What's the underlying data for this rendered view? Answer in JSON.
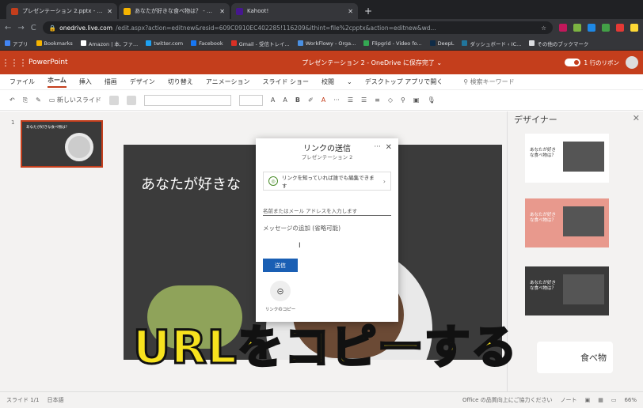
{
  "browser": {
    "tabs": [
      {
        "label": "プレゼンテーション 2.pptx - Micr",
        "color": "#c43e1c",
        "active": true
      },
      {
        "label": "あなたが好きな食べ物は？ - Goo",
        "color": "#f6b400",
        "active": false
      },
      {
        "label": "Kahoot!",
        "color": "#46178f",
        "active": false
      }
    ],
    "new_tab": "+",
    "address": {
      "host": "onedrive.live.com",
      "path": "/edit.aspx?action=editnew&resid=609C0910EC402285!116209&ithint=file%2cpptx&action=editnew&wd..."
    },
    "bookmarks": [
      {
        "label": "アプリ",
        "color": "#4285f4"
      },
      {
        "label": "Bookmarks",
        "color": "#f6b400"
      },
      {
        "label": "Amazon | 本, ファ...",
        "color": "#ffffff"
      },
      {
        "label": "twitter.com",
        "color": "#1da1f2"
      },
      {
        "label": "Facebook",
        "color": "#1877f2"
      },
      {
        "label": "Gmail - 受信トレイ...",
        "color": "#d93025"
      },
      {
        "label": "WorkFlowy - Orga...",
        "color": "#4a90e2"
      },
      {
        "label": "Flipgrid - Video fo...",
        "color": "#34a853"
      },
      {
        "label": "DeepL",
        "color": "#0f2b46"
      },
      {
        "label": "ダッシュボード ‹ IC...",
        "color": "#21759b"
      },
      {
        "label": "その他のブックマーク",
        "color": "#dadce0"
      }
    ]
  },
  "ppt": {
    "app_name": "PowerPoint",
    "doc_title": "プレゼンテーション 2 - OneDrive に保存完了 ⌄",
    "ribbon_toggle": "1 行のリボン",
    "brand_color": "#c43e1c",
    "menu": [
      "ファイル",
      "ホーム",
      "挿入",
      "描画",
      "デザイン",
      "切り替え",
      "アニメーション",
      "スライド ショー",
      "校閲",
      "⌄",
      "デスクトップ アプリで開く"
    ],
    "search_placeholder": "検索キーワード",
    "toolbar_new_slide": "新しいスライド",
    "slide_number": "1",
    "thumb_title": "あなたが好きな食べ物は？",
    "slide_title": "あなたが好きな",
    "designer": {
      "title": "デザイナー",
      "items": [
        {
          "text": "あなたが好きな食べ物は？",
          "bg": "#ffffff",
          "fg": "#333333"
        },
        {
          "text": "あなたが好きな食べ物は？",
          "bg": "#e8998d",
          "fg": "#ffffff"
        },
        {
          "text": "あなたが好きな食べ物は？",
          "bg": "#3a3a3a",
          "fg": "#ffffff"
        }
      ]
    },
    "status": {
      "slide": "スライド 1/1",
      "language": "日本語",
      "feedback": "Office の品質向上にご協力ください",
      "notes": "ノート",
      "zoom": "66%"
    }
  },
  "dialog": {
    "title": "リンクの送信",
    "subtitle": "プレゼンテーション 2",
    "more": "···",
    "close": "✕",
    "permission": "リンクを知っていれば誰でも編集できます",
    "name_placeholder": "名前またはメール アドレスを入力します",
    "message_placeholder": "メッセージの追加 (省略可能)",
    "send": "送信",
    "copy_label": "リンクのコピー"
  },
  "caption": {
    "text": "URLをコピーする",
    "corner_text": "食べ物"
  }
}
